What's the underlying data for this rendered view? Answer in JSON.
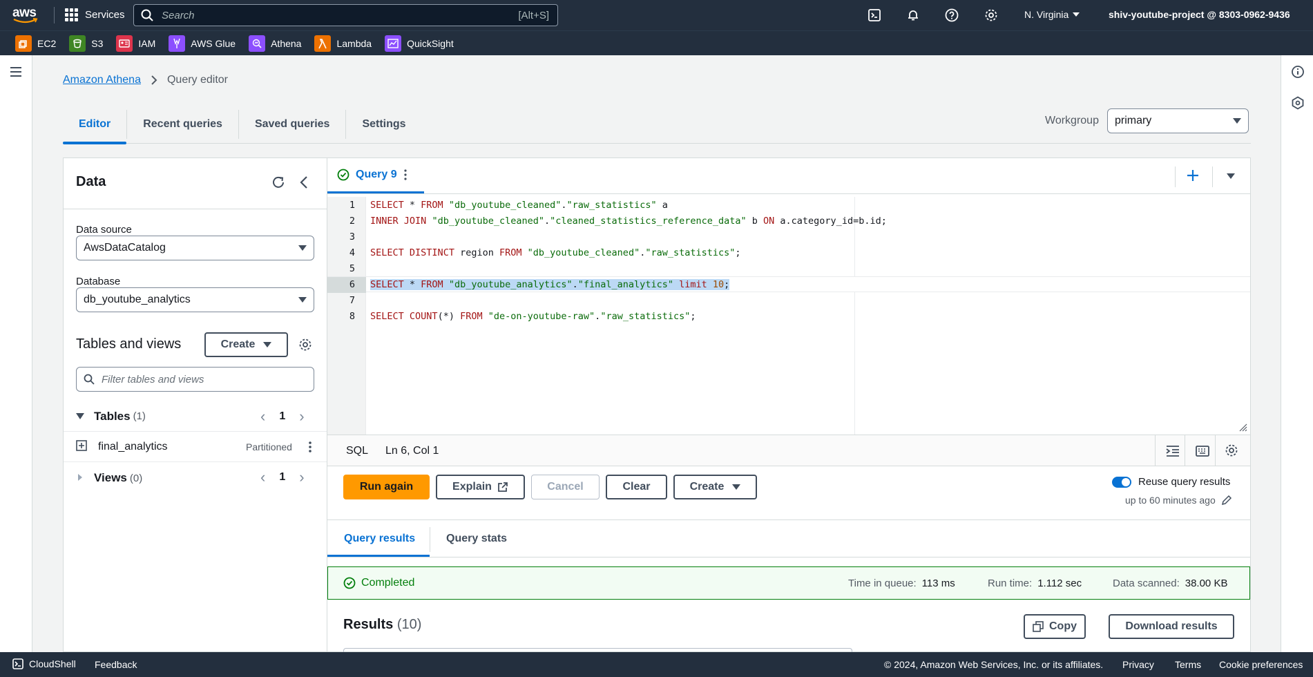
{
  "topnav": {
    "logo": "aws",
    "services_label": "Services",
    "search_placeholder": "Search",
    "search_shortcut": "[Alt+S]",
    "region": "N. Virginia",
    "account": "shiv-youtube-project @ 8303-0962-9436",
    "icons": [
      "cloudshell-icon",
      "bell-icon",
      "help-icon",
      "gear-icon"
    ]
  },
  "favorites": [
    {
      "label": "EC2",
      "color": "#ed7100"
    },
    {
      "label": "S3",
      "color": "#3f8624"
    },
    {
      "label": "IAM",
      "color": "#dd344c"
    },
    {
      "label": "AWS Glue",
      "color": "#8c4fff"
    },
    {
      "label": "Athena",
      "color": "#8c4fff"
    },
    {
      "label": "Lambda",
      "color": "#ed7100"
    },
    {
      "label": "QuickSight",
      "color": "#8c4fff"
    }
  ],
  "breadcrumb": {
    "root": "Amazon Athena",
    "current": "Query editor"
  },
  "tabs": [
    {
      "label": "Editor",
      "active": true
    },
    {
      "label": "Recent queries",
      "active": false
    },
    {
      "label": "Saved queries",
      "active": false
    },
    {
      "label": "Settings",
      "active": false
    }
  ],
  "workgroup": {
    "label": "Workgroup",
    "value": "primary"
  },
  "data_panel": {
    "title": "Data",
    "data_source_label": "Data source",
    "data_source_value": "AwsDataCatalog",
    "database_label": "Database",
    "database_value": "db_youtube_analytics",
    "tables_views_title": "Tables and views",
    "create_label": "Create",
    "filter_placeholder": "Filter tables and views",
    "tables": {
      "label": "Tables",
      "count": "(1)",
      "page": "1"
    },
    "table_item": {
      "name": "final_analytics",
      "badge": "Partitioned"
    },
    "views": {
      "label": "Views",
      "count": "(0)",
      "page": "1"
    }
  },
  "editor": {
    "query_tab": "Query 9",
    "lines": [
      {
        "n": "1",
        "text": "SELECT * FROM \"db_youtube_cleaned\".\"raw_statistics\" a"
      },
      {
        "n": "2",
        "text": "INNER JOIN \"db_youtube_cleaned\".\"cleaned_statistics_reference_data\" b ON a.category_id=b.id;"
      },
      {
        "n": "3",
        "text": ""
      },
      {
        "n": "4",
        "text": "SELECT DISTINCT region FROM \"db_youtube_cleaned\".\"raw_statistics\";"
      },
      {
        "n": "5",
        "text": ""
      },
      {
        "n": "6",
        "text": "SELECT * FROM \"db_youtube_analytics\".\"final_analytics\" limit 10;"
      },
      {
        "n": "7",
        "text": ""
      },
      {
        "n": "8",
        "text": "SELECT COUNT(*) FROM \"de-on-youtube-raw\".\"raw_statistics\";"
      }
    ],
    "language": "SQL",
    "cursor": "Ln 6, Col 1"
  },
  "actions": {
    "run": "Run again",
    "explain": "Explain",
    "cancel": "Cancel",
    "clear": "Clear",
    "create": "Create",
    "reuse_label": "Reuse query results",
    "reuse_sub": "up to 60 minutes ago"
  },
  "results": {
    "tabs": [
      "Query results",
      "Query stats"
    ],
    "status": "Completed",
    "time_in_queue_label": "Time in queue:",
    "time_in_queue": "113 ms",
    "run_time_label": "Run time:",
    "run_time": "1.112 sec",
    "data_scanned_label": "Data scanned:",
    "data_scanned": "38.00 KB",
    "title": "Results",
    "count": "(10)",
    "copy": "Copy",
    "download": "Download results"
  },
  "footer": {
    "cloudshell": "CloudShell",
    "feedback": "Feedback",
    "copyright": "© 2024, Amazon Web Services, Inc. or its affiliates.",
    "privacy": "Privacy",
    "terms": "Terms",
    "cookies": "Cookie preferences"
  }
}
